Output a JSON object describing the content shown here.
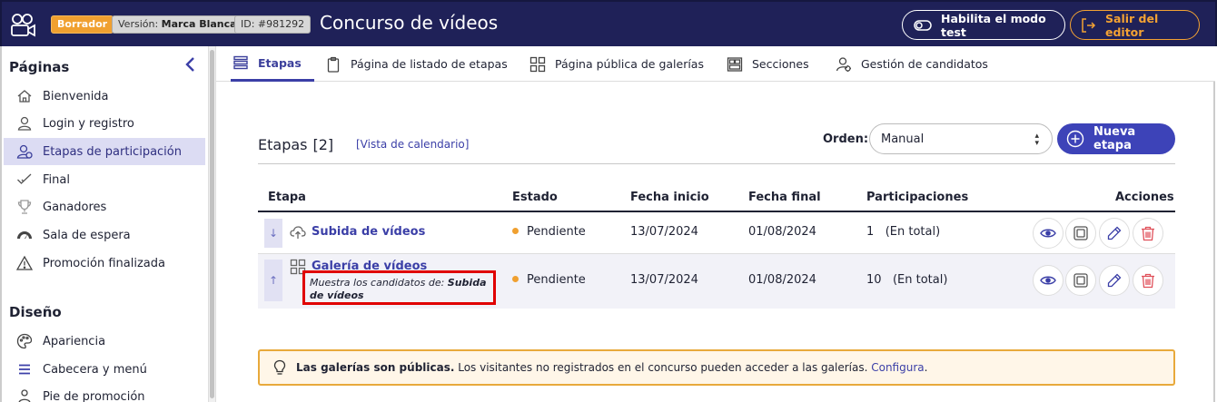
{
  "topbar": {
    "draft_badge": "Borrador",
    "version_prefix": "Versión: ",
    "version_value": "Marca Blanca",
    "id_badge": "ID: #981292",
    "title": "Concurso de vídeos",
    "test_mode_label": "Habilita el modo test",
    "exit_label": "Salir del editor"
  },
  "sidebar": {
    "pages_heading": "Páginas",
    "design_heading": "Diseño",
    "pages": [
      {
        "label": "Bienvenida",
        "icon": "home-icon"
      },
      {
        "label": "Login y registro",
        "icon": "user-icon"
      },
      {
        "label": "Etapas de participación",
        "icon": "users-icon",
        "active": true
      },
      {
        "label": "Final",
        "icon": "check-icon"
      },
      {
        "label": "Ganadores",
        "icon": "trophy-icon"
      },
      {
        "label": "Sala de espera",
        "icon": "gauge-icon"
      },
      {
        "label": "Promoción finalizada",
        "icon": "warning-icon"
      }
    ],
    "design": [
      {
        "label": "Apariencia",
        "icon": "palette-icon"
      },
      {
        "label": "Cabecera y menú",
        "icon": "menu-icon"
      },
      {
        "label": "Pie de promoción",
        "icon": "footer-icon"
      }
    ]
  },
  "tabs": [
    {
      "label": "Etapas",
      "icon": "list-icon",
      "active": true
    },
    {
      "label": "Página de listado de etapas",
      "icon": "clipboard-icon"
    },
    {
      "label": "Página pública de galerías",
      "icon": "grid-icon"
    },
    {
      "label": "Secciones",
      "icon": "sections-icon"
    },
    {
      "label": "Gestión de candidatos",
      "icon": "candidates-icon"
    }
  ],
  "stages": {
    "title": "Etapas",
    "count": "[2]",
    "calendar_link": "[Vista de calendario]",
    "order_label": "Orden:",
    "order_value": "Manual",
    "new_stage_label": "Nueva etapa",
    "columns": [
      "Etapa",
      "Estado",
      "Fecha inicio",
      "Fecha final",
      "Participaciones",
      "Acciones"
    ],
    "rows": [
      {
        "move": "↓",
        "icon": "upload-cloud-icon",
        "name": "Subida de vídeos",
        "status": "Pendiente",
        "start": "13/07/2024",
        "end": "01/08/2024",
        "participations": "1",
        "participations_note": "(En total)"
      },
      {
        "move": "↑",
        "icon": "gallery-icon",
        "name": "Galería de vídeos",
        "desc_prefix": "Muestra los candidatos de: ",
        "desc_value": "Subida de vídeos",
        "status": "Pendiente",
        "start": "13/07/2024",
        "end": "01/08/2024",
        "participations": "10",
        "participations_note": "(En total)"
      }
    ]
  },
  "banner": {
    "bold": "Las galerías son públicas.",
    "text": " Los visitantes no registrados en el concurso pueden acceder a las galerías. ",
    "link": "Configura",
    "end": "."
  },
  "colors": {
    "topbar": "#1f2158",
    "accent": "#3d43b8",
    "draft": "#f0a030",
    "exit": "#f3a233",
    "delete": "#e0505a",
    "highlight": "#e00000"
  }
}
